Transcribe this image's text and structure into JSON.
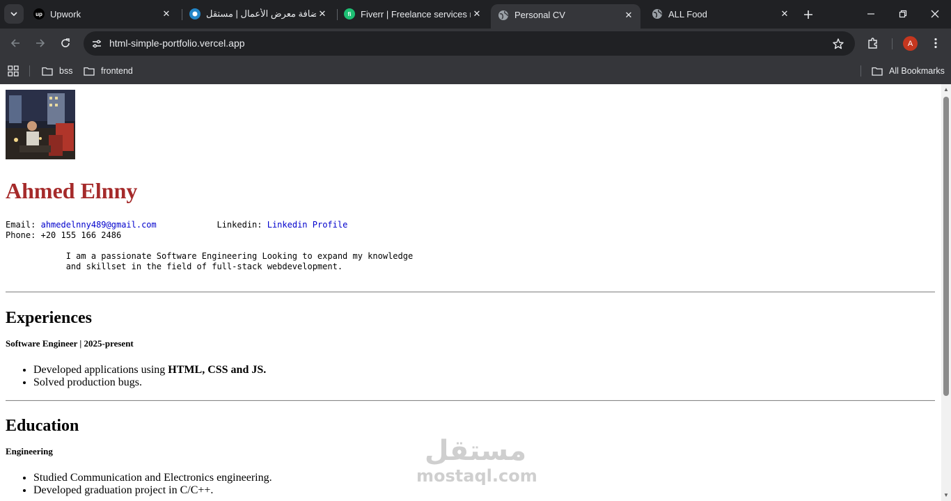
{
  "browser": {
    "tabs": [
      {
        "title": "Upwork",
        "favicon": "upwork-icon",
        "fav_text": "up",
        "fav_bg": "#000000",
        "fav_fg": "#ffffff",
        "active": false
      },
      {
        "title": "إضافة معرض الأعمال | مستقل",
        "favicon": "mostaql-icon",
        "fav_text": "",
        "fav_bg": "#2386c8",
        "fav_fg": "#ffffff",
        "active": false
      },
      {
        "title": "Fiverr | Freelance services ma",
        "favicon": "fiverr-icon",
        "fav_text": "fi",
        "fav_bg": "#1dbf73",
        "fav_fg": "#ffffff",
        "active": false
      },
      {
        "title": "Personal CV",
        "favicon": "globe-icon",
        "fav_text": "",
        "fav_bg": "#9aa0a6",
        "fav_fg": "#35363a",
        "active": true
      },
      {
        "title": "ALL Food",
        "favicon": "globe-icon",
        "fav_text": "",
        "fav_bg": "#9aa0a6",
        "fav_fg": "#202124",
        "active": false
      }
    ],
    "url": "html-simple-portfolio.vercel.app",
    "avatar_letter": "A",
    "bookmarks": [
      {
        "label": "bss"
      },
      {
        "label": "frontend"
      }
    ],
    "all_bookmarks_label": "All Bookmarks"
  },
  "cv": {
    "name": "Ahmed Elnny",
    "contact": {
      "email_label": "Email:",
      "email": "ahmedelnny489@gmail.com",
      "linkedin_label": "Linkedin:",
      "linkedin_text": "Linkedin Profile",
      "phone_label": "Phone:",
      "phone": "+20 155 166 2486"
    },
    "about": {
      "line1": "I am a passionate Software Engineering Looking to expand my knowledge",
      "line2": "and skillset in the field of full-stack webdevelopment."
    },
    "experiences": {
      "heading": "Experiences",
      "role": "Software Engineer | 2025-present",
      "bullets": {
        "b1_prefix": "Developed applications using ",
        "b1_bold": "HTML, CSS and JS.",
        "b2": "Solved production bugs."
      }
    },
    "education": {
      "heading": "Education",
      "title": "Engineering",
      "bullets": {
        "b1": "Studied Communication and Electronics engineering.",
        "b2": "Developed graduation project in C/C++."
      }
    }
  },
  "watermark": {
    "arabic": "مستقل",
    "latin": "mostaql.com"
  },
  "colors": {
    "name_color": "#a52a2a",
    "link_color": "#0000cc",
    "tab_strip": "#202124",
    "toolbar": "#35363a"
  }
}
